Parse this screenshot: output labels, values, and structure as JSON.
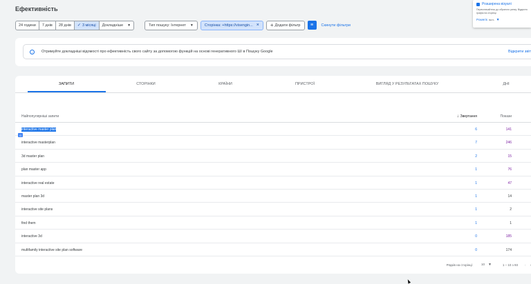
{
  "page": {
    "title": "Ефективність"
  },
  "filters": {
    "date_ranges": [
      {
        "label": "24 години",
        "active": false
      },
      {
        "label": "7 днів",
        "active": false
      },
      {
        "label": "28 днів",
        "active": false
      },
      {
        "label": "3 місяці",
        "active": true
      },
      {
        "label": "Докладніше",
        "active": false
      }
    ],
    "search_type": "Тип пошуку: Інтернет",
    "page_filter": "Сторінка: +https://visengin...",
    "add_filter": "Додати фільтр",
    "reset": "Скинути фільтри"
  },
  "popup": {
    "title": "Розширена візуалі",
    "text": "Переключайтесь до обраного ринку. Відкрито графік на сторінці",
    "footer": "Poweris",
    "beta": "BETA"
  },
  "info": {
    "text": "Отримуйте докладніші відомості про ефективність свого сайту за допомогою функцій на основі генеративного ШІ в Пошуку Google",
    "link": "Відкрити звіт"
  },
  "tabs": [
    {
      "label": "ЗАПИТИ",
      "active": true
    },
    {
      "label": "СТОРІНКИ",
      "active": false
    },
    {
      "label": "КРАЇНИ",
      "active": false
    },
    {
      "label": "ПРИСТРОЇ",
      "active": false
    },
    {
      "label": "ВИГЛЯД У РЕЗУЛЬТАТАХ ПОШУКУ",
      "active": false
    },
    {
      "label": "ДНІ",
      "active": false
    }
  ],
  "table": {
    "headers": {
      "query": "Найпопулярніші запити",
      "clicks": "Звертання",
      "impressions": "Покази"
    },
    "rows": [
      {
        "query": "interactive master plan",
        "clicks": "6",
        "impressions": "141"
      },
      {
        "query": "interactive masterplan",
        "clicks": "7",
        "impressions": "246"
      },
      {
        "query": "3d master plan",
        "clicks": "2",
        "impressions": "15"
      },
      {
        "query": "plan master app",
        "clicks": "1",
        "impressions": "76"
      },
      {
        "query": "interactive real estate",
        "clicks": "1",
        "impressions": "47"
      },
      {
        "query": "master plan 3d",
        "clicks": "1",
        "impressions": "14"
      },
      {
        "query": "interactive site plans",
        "clicks": "1",
        "impressions": "2"
      },
      {
        "query": "find them",
        "clicks": "1",
        "impressions": "1"
      },
      {
        "query": "interactive 3d",
        "clicks": "0",
        "impressions": "185"
      },
      {
        "query": "multifamily interactive site plan software",
        "clicks": "0",
        "impressions": "174"
      }
    ]
  },
  "pagination": {
    "rows_label": "Рядків на сторінці:",
    "rows_value": "10",
    "range": "1 – 10 з 93"
  }
}
